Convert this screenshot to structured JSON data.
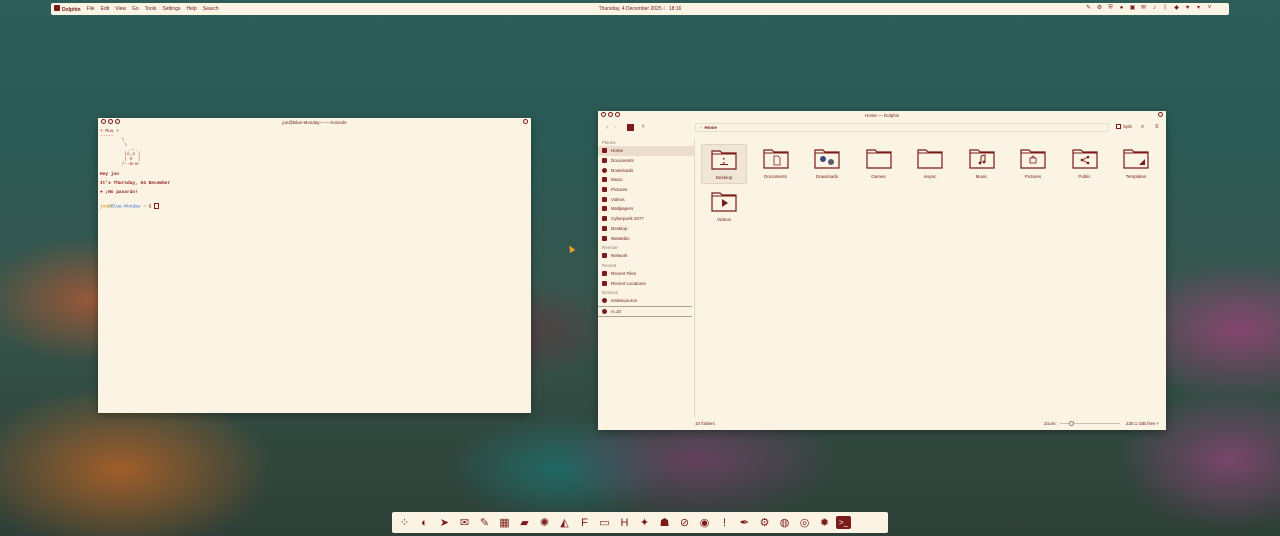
{
  "topbar": {
    "app_name": "Dolphin",
    "menu": [
      "File",
      "Edit",
      "View",
      "Go",
      "Tools",
      "Settings",
      "Help",
      "Search"
    ],
    "date": "Thursday, 4 December 2025",
    "time": "18:16",
    "tray_icons": [
      "pen-icon",
      "settings-icon",
      "shield-icon",
      "record-icon",
      "screenshot-icon",
      "mail-icon",
      "volume-icon",
      "bluetooth-icon",
      "vpn-icon",
      "shield-heart-icon",
      "network-icon",
      "chevron-down-icon"
    ]
  },
  "konsole": {
    "title": "jon@Blue-Monday:~ — Konsole",
    "cow_bubble": "< Muu >",
    "cow_line": " -----",
    "cow_art": "        \\\n         \\\n          .--.\n         |o_o |\n         | V  |\n        /--m-m-",
    "greeting": "Hey jon",
    "date_line": "It's Thursday, 04 December",
    "motto": "¡No pasarán!",
    "prompt_user": "jon",
    "prompt_at": "@",
    "prompt_host": "Blue-Monday",
    "prompt_rest": " ~ $ "
  },
  "dolphin": {
    "title": "Home — Dolphin",
    "breadcrumb": "Home",
    "split_label": "Split",
    "places_header": "Places",
    "places": [
      {
        "label": "Home",
        "icon": "home-icon",
        "active": true
      },
      {
        "label": "Documents",
        "icon": "documents-icon"
      },
      {
        "label": "Downloads",
        "icon": "downloads-icon"
      },
      {
        "label": "Music",
        "icon": "music-icon"
      },
      {
        "label": "Pictures",
        "icon": "pictures-icon"
      },
      {
        "label": "Videos",
        "icon": "videos-icon"
      },
      {
        "label": "Wallpapers",
        "icon": "folder-icon"
      },
      {
        "label": "Cyberpunk 2077",
        "icon": "folder-icon"
      },
      {
        "label": "Desktop",
        "icon": "desktop-icon"
      },
      {
        "label": "Wastebin",
        "icon": "trash-icon"
      }
    ],
    "remote_header": "Remote",
    "remote": [
      {
        "label": "Network",
        "icon": "network-icon"
      }
    ],
    "recent_header": "Recent",
    "recent": [
      {
        "label": "Recent Files",
        "icon": "recent-files-icon"
      },
      {
        "label": "Recent Locations",
        "icon": "recent-locations-icon"
      }
    ],
    "devices_header": "Devices",
    "devices": [
      {
        "label": "endeavouros",
        "icon": "drive-icon"
      },
      {
        "label": "m.10",
        "icon": "drive-icon"
      }
    ],
    "folders": [
      {
        "label": "Desktop",
        "emblem": "desktop"
      },
      {
        "label": "Documents",
        "emblem": "document"
      },
      {
        "label": "Downloads",
        "emblem": "downloads"
      },
      {
        "label": "Games",
        "emblem": "none"
      },
      {
        "label": "insync",
        "emblem": "none"
      },
      {
        "label": "Music",
        "emblem": "music"
      },
      {
        "label": "Pictures",
        "emblem": "pictures"
      },
      {
        "label": "Public",
        "emblem": "share"
      },
      {
        "label": "Templates",
        "emblem": "templates"
      },
      {
        "label": "Videos",
        "emblem": "video"
      }
    ],
    "status": "10 folders",
    "zoom_label": "Zoom:",
    "zoom_level": 0.2,
    "free_space": "230.1 GiB free"
  },
  "dock": {
    "icons": [
      "launcher-icon",
      "firefox-icon",
      "telegram-icon",
      "mail-app-icon",
      "notes-icon",
      "calculator-icon",
      "files-icon",
      "aperture-icon",
      "inkscape-icon",
      "text-editor-icon",
      "media-icon",
      "hex-icon",
      "game-icon",
      "mask-icon",
      "block-icon",
      "blender-icon",
      "warning-icon",
      "pen-tool-icon",
      "steam-icon",
      "obs-icon",
      "webcam-icon",
      "settings-icon",
      "terminal-icon"
    ]
  },
  "colors": {
    "accent": "#7a1a1a",
    "surface": "#fbf4e4"
  }
}
